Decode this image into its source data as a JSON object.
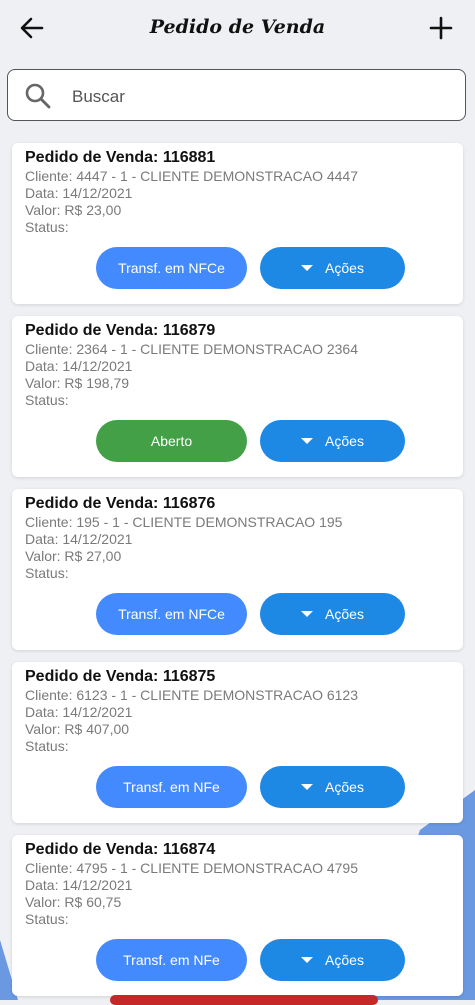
{
  "header": {
    "title": "Pedido de Venda"
  },
  "search": {
    "placeholder": "Buscar"
  },
  "labels": {
    "order_prefix": "Pedido de Venda: ",
    "client_prefix": "Cliente: ",
    "date_prefix": "Data: ",
    "value_prefix": "Valor: R$ ",
    "status_label": "Status:",
    "actions": "Ações"
  },
  "colors": {
    "primary_button": "#448aff",
    "aberto_button": "#43a047",
    "actions_button": "#1e88e5",
    "bottom_peek": "#c62828"
  },
  "icons": {
    "back": "arrow-left-icon",
    "add": "plus-icon",
    "search": "search-icon",
    "dropdown": "caret-down-icon"
  },
  "orders": [
    {
      "number": "116881",
      "client": "4447 - 1 - CLIENTE DEMONSTRACAO 4447",
      "date": "14/12/2021",
      "value": "23,00",
      "status_button": "Transf. em NFCe",
      "status_type": "primary"
    },
    {
      "number": "116879",
      "client": "2364 - 1 - CLIENTE DEMONSTRACAO 2364",
      "date": "14/12/2021",
      "value": "198,79",
      "status_button": "Aberto",
      "status_type": "aberto"
    },
    {
      "number": "116876",
      "client": "195 - 1 - CLIENTE DEMONSTRACAO 195",
      "date": "14/12/2021",
      "value": "27,00",
      "status_button": "Transf. em NFCe",
      "status_type": "primary"
    },
    {
      "number": "116875",
      "client": "6123 - 1 - CLIENTE DEMONSTRACAO 6123",
      "date": "14/12/2021",
      "value": "407,00",
      "status_button": "Transf. em NFe",
      "status_type": "primary"
    },
    {
      "number": "116874",
      "client": "4795 - 1 - CLIENTE DEMONSTRACAO 4795",
      "date": "14/12/2021",
      "value": "60,75",
      "status_button": "Transf. em NFe",
      "status_type": "primary"
    }
  ]
}
